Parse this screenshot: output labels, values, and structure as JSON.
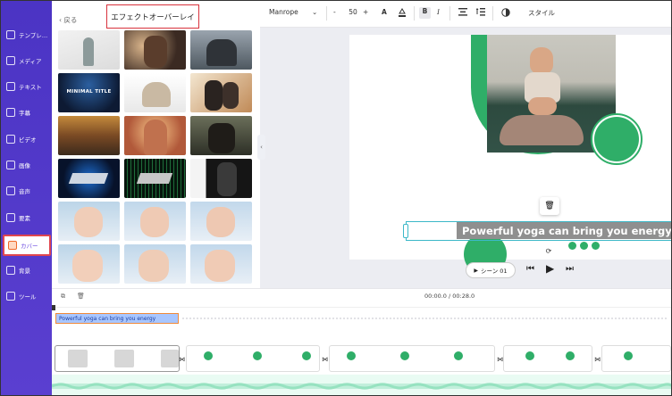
{
  "sidebar": {
    "items": [
      {
        "label": "テンプレ…",
        "icon": "template-icon"
      },
      {
        "label": "メディア",
        "icon": "media-icon"
      },
      {
        "label": "テキスト",
        "icon": "text-icon"
      },
      {
        "label": "字幕",
        "icon": "subtitle-icon"
      },
      {
        "label": "ビデオ",
        "icon": "video-icon"
      },
      {
        "label": "画像",
        "icon": "image-icon"
      },
      {
        "label": "音声",
        "icon": "audio-icon"
      },
      {
        "label": "要素",
        "icon": "elements-icon"
      },
      {
        "label": "カバー",
        "icon": "cover-icon",
        "active": true
      },
      {
        "label": "背景",
        "icon": "background-icon"
      },
      {
        "label": "ツール",
        "icon": "tools-icon"
      }
    ]
  },
  "library": {
    "back_label": "‹ 戻る",
    "title": "エフェクトオーバーレイ",
    "thumb_text_minimal": "MINIMAL TITLE"
  },
  "toolbar": {
    "font_name": "Manrope",
    "font_size": "50",
    "minus": "-",
    "plus": "+",
    "style_label": "スタイル"
  },
  "canvas": {
    "headline": "Powerful yoga can bring you energy"
  },
  "player": {
    "scene_label": "シーン 01"
  },
  "timeline": {
    "time": "00:00.0 / 00:28.0",
    "text_track": "Powerful yoga can bring you energy"
  },
  "colors": {
    "sidebar": "#4b34c4",
    "accent_green": "#2fae68",
    "highlight_red": "#d8323c",
    "timeline_text": "#a8c6ff",
    "audio_green": "#7ddab0"
  }
}
